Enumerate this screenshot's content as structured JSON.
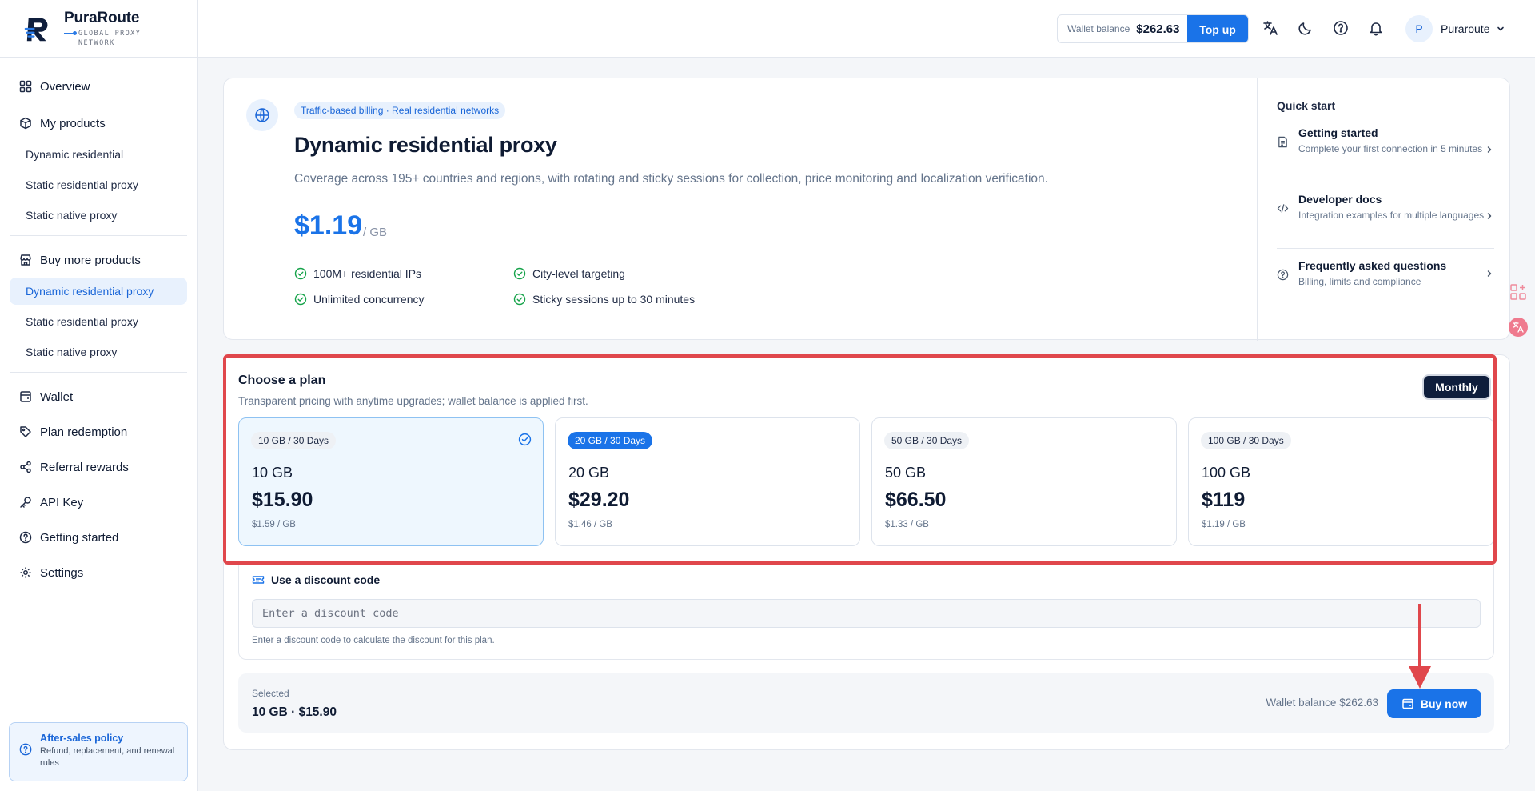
{
  "brand": {
    "name": "PuraRoute",
    "tagline": "GLOBAL PROXY NETWORK"
  },
  "sidebar": {
    "overview": "Overview",
    "my_products": {
      "label": "My products",
      "items": [
        "Dynamic residential",
        "Static residential proxy",
        "Static native proxy"
      ]
    },
    "buy_more": {
      "label": "Buy more products",
      "items": [
        "Dynamic residential proxy",
        "Static residential proxy",
        "Static native proxy"
      ],
      "active_index": 0
    },
    "bottom": [
      "Wallet",
      "Plan redemption",
      "Referral rewards",
      "API Key",
      "Getting started",
      "Settings"
    ],
    "after_sales": {
      "title": "After-sales policy",
      "desc": "Refund, replacement, and renewal rules"
    }
  },
  "topbar": {
    "wallet_label": "Wallet balance",
    "wallet_value": "$262.63",
    "topup": "Top up",
    "icons": [
      "translate-icon",
      "moon-icon",
      "help-icon",
      "bell-icon"
    ],
    "user": {
      "initial": "P",
      "name": "Puraroute"
    }
  },
  "hero": {
    "tag": "Traffic-based billing · Real residential networks",
    "title": "Dynamic residential proxy",
    "desc": "Coverage across 195+ countries and regions, with rotating and sticky sessions for collection, price monitoring and localization verification.",
    "price": "$1.19",
    "unit": "/ GB",
    "features": [
      "100M+ residential IPs",
      "City-level targeting",
      "Unlimited concurrency",
      "Sticky sessions up to 30 minutes"
    ]
  },
  "quick_start": {
    "title": "Quick start",
    "items": [
      {
        "title": "Getting started",
        "desc": "Complete your first connection in 5 minutes",
        "icon": "document-icon"
      },
      {
        "title": "Developer docs",
        "desc": "Integration examples for multiple languages",
        "icon": "code-icon"
      },
      {
        "title": "Frequently asked questions",
        "desc": "Billing, limits and compliance",
        "icon": "help-icon"
      }
    ]
  },
  "plans": {
    "title": "Choose a plan",
    "subtitle": "Transparent pricing with anytime upgrades; wallet balance is applied first.",
    "period": "Monthly",
    "options": [
      {
        "badge": "10 GB / 30 Days",
        "size": "10 GB",
        "price": "$15.90",
        "per_gb": "$1.59 / GB",
        "selected": true
      },
      {
        "badge": "20 GB / 30 Days",
        "size": "20 GB",
        "price": "$29.20",
        "per_gb": "$1.46 / GB",
        "featured": true
      },
      {
        "badge": "50 GB / 30 Days",
        "size": "50 GB",
        "price": "$66.50",
        "per_gb": "$1.33 / GB"
      },
      {
        "badge": "100 GB / 30 Days",
        "size": "100 GB",
        "price": "$119",
        "per_gb": "$1.19 / GB"
      }
    ]
  },
  "discount": {
    "title": "Use a discount code",
    "placeholder": "Enter a discount code",
    "help": "Enter a discount code to calculate the discount for this plan."
  },
  "summary": {
    "label": "Selected",
    "value": "10 GB · $15.90",
    "wallet": "Wallet balance $262.63",
    "buy": "Buy now"
  },
  "colors": {
    "accent": "#1a73e8",
    "highlight": "#e0474c",
    "dark_button": "#0f1e3c",
    "check": "#16a34a"
  }
}
